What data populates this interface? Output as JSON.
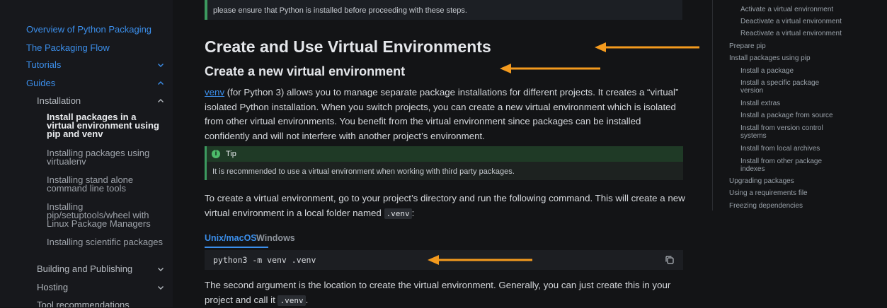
{
  "sidebar": {
    "top_links": [
      "Overview of Python Packaging",
      "The Packaging Flow"
    ],
    "tutorials": "Tutorials",
    "guides": "Guides",
    "installation": "Installation",
    "installation_items": [
      "Install packages in a virtual environment using pip and venv",
      "Installing packages using virtualenv",
      "Installing stand alone command line tools",
      "Installing pip/setuptools/wheel with Linux Package Managers",
      "Installing scientific packages"
    ],
    "building": "Building and Publishing",
    "hosting": "Hosting",
    "tool_recs": "Tool recommendations"
  },
  "main": {
    "note_text": "please ensure that Python is installed before proceeding with these steps.",
    "h1": "Create and Use Virtual Environments",
    "h2": "Create a new virtual environment",
    "intro_link": "venv",
    "intro_rest": " (for Python 3) allows you to manage separate package installations for different projects. It creates a “virtual” isolated Python installation. When you switch projects, you can create a new virtual environment which is isolated from other virtual environments. You benefit from the virtual environment since packages can be installed confidently and will not interfere with another project’s environment.",
    "tip": {
      "icon": "i",
      "title": "Tip",
      "body": "It is recommended to use a virtual environment when working with third party packages."
    },
    "para2_pre": "To create a virtual environment, go to your project’s directory and run the following command. This will create a new virtual environment in a local folder named ",
    "para2_code": ".venv",
    "para2_post": ":",
    "tabs": [
      "Unix/macOS",
      "Windows"
    ],
    "command": "python3 -m venv .venv",
    "para3_pre": "The second argument is the location to create the virtual environment. Generally, you can just create this in your project and call it ",
    "para3_code": ".venv",
    "para3_post": "."
  },
  "toc": {
    "items": [
      "Activate a virtual environment",
      "Deactivate a virtual environment",
      "Reactivate a virtual environment",
      "Prepare pip",
      "Install packages using pip",
      "Install a package",
      "Install a specific package",
      "version",
      "Install extras",
      "Install a package from source",
      "Install from version control",
      "systems",
      "Install from local archives",
      "Install from other package",
      "indexes",
      "Upgrading packages",
      "Using a requirements file",
      "Freezing dependencies"
    ]
  },
  "colors": {
    "accent": "#3b8eea",
    "arrow": "#f39a1e",
    "tip_green": "#3c9a5f"
  },
  "icons": [
    "chevron-down-icon",
    "chevron-up-icon",
    "info-icon",
    "copy-icon",
    "arrow-left-icon"
  ]
}
